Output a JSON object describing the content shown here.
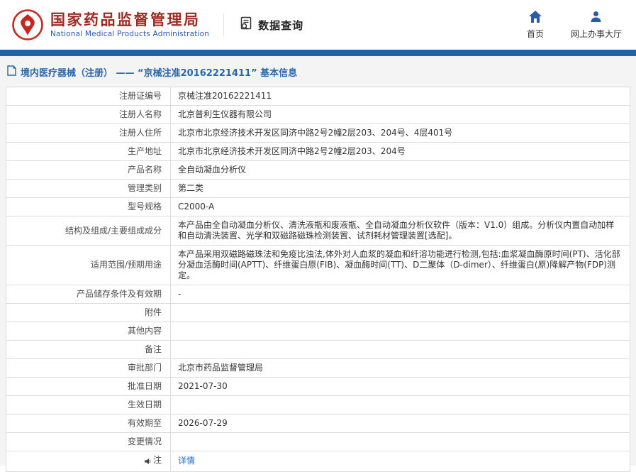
{
  "header": {
    "title": "国家药品监督管理局",
    "subtitle": "National Medical Products Administration",
    "section": "数据查询",
    "nav_home": "首页",
    "nav_hall": "网上办事大厅"
  },
  "breadcrumb": "境内医疗器械（注册） ——  “京械注准20162221411” 基本信息",
  "colors": {
    "brand_red": "#9e2b23",
    "brand_blue": "#2a5caa",
    "bar_blue": "#1e63ad",
    "link_blue": "#2a6fc9"
  },
  "table": {
    "rows": [
      {
        "label": "注册证编号",
        "value": "京械注准20162221411"
      },
      {
        "label": "注册人名称",
        "value": "北京普利生仪器有限公司"
      },
      {
        "label": "注册人住所",
        "value": "北京市北京经济技术开发区同济中路2号2幢2层203、204号、4层401号"
      },
      {
        "label": "生产地址",
        "value": "北京市北京经济技术开发区同济中路2号2幢2层203、204号"
      },
      {
        "label": "产品名称",
        "value": "全自动凝血分析仪"
      },
      {
        "label": "管理类别",
        "value": "第二类"
      },
      {
        "label": "型号规格",
        "value": "C2000-A"
      },
      {
        "label": "结构及组成/主要组成成分",
        "value": "本产品由全自动凝血分析仪、清洗液瓶和废液瓶、全自动凝血分析仪软件（版本：V1.0）组成。分析仪内置自动加样和自动清洗装置、光学和双磁路磁珠检测装置、试剂耗材管理装置[选配]。"
      },
      {
        "label": "适用范围/预期用途",
        "value": "本产品采用双磁路磁珠法和免疫比浊法,体外对人血浆的凝血和纤溶功能进行检测,包括:血浆凝血酶原时间(PT)、活化部分凝血活酶时间(APTT)、纤维蛋白原(FIB)、凝血酶时间(TT)、D二聚体（D-dimer）、纤维蛋白(原)降解产物(FDP)测定。"
      },
      {
        "label": "产品储存条件及有效期",
        "value": "-"
      },
      {
        "label": "附件",
        "value": ""
      },
      {
        "label": "其他内容",
        "value": ""
      },
      {
        "label": "备注",
        "value": ""
      },
      {
        "label": "审批部门",
        "value": "北京市药品监督管理局"
      },
      {
        "label": "批准日期",
        "value": "2021-07-30"
      },
      {
        "label": "生效日期",
        "value": ""
      },
      {
        "label": "有效期至",
        "value": "2026-07-29"
      },
      {
        "label": "变更情况",
        "value": ""
      },
      {
        "label": "注",
        "value": "详情"
      }
    ]
  }
}
